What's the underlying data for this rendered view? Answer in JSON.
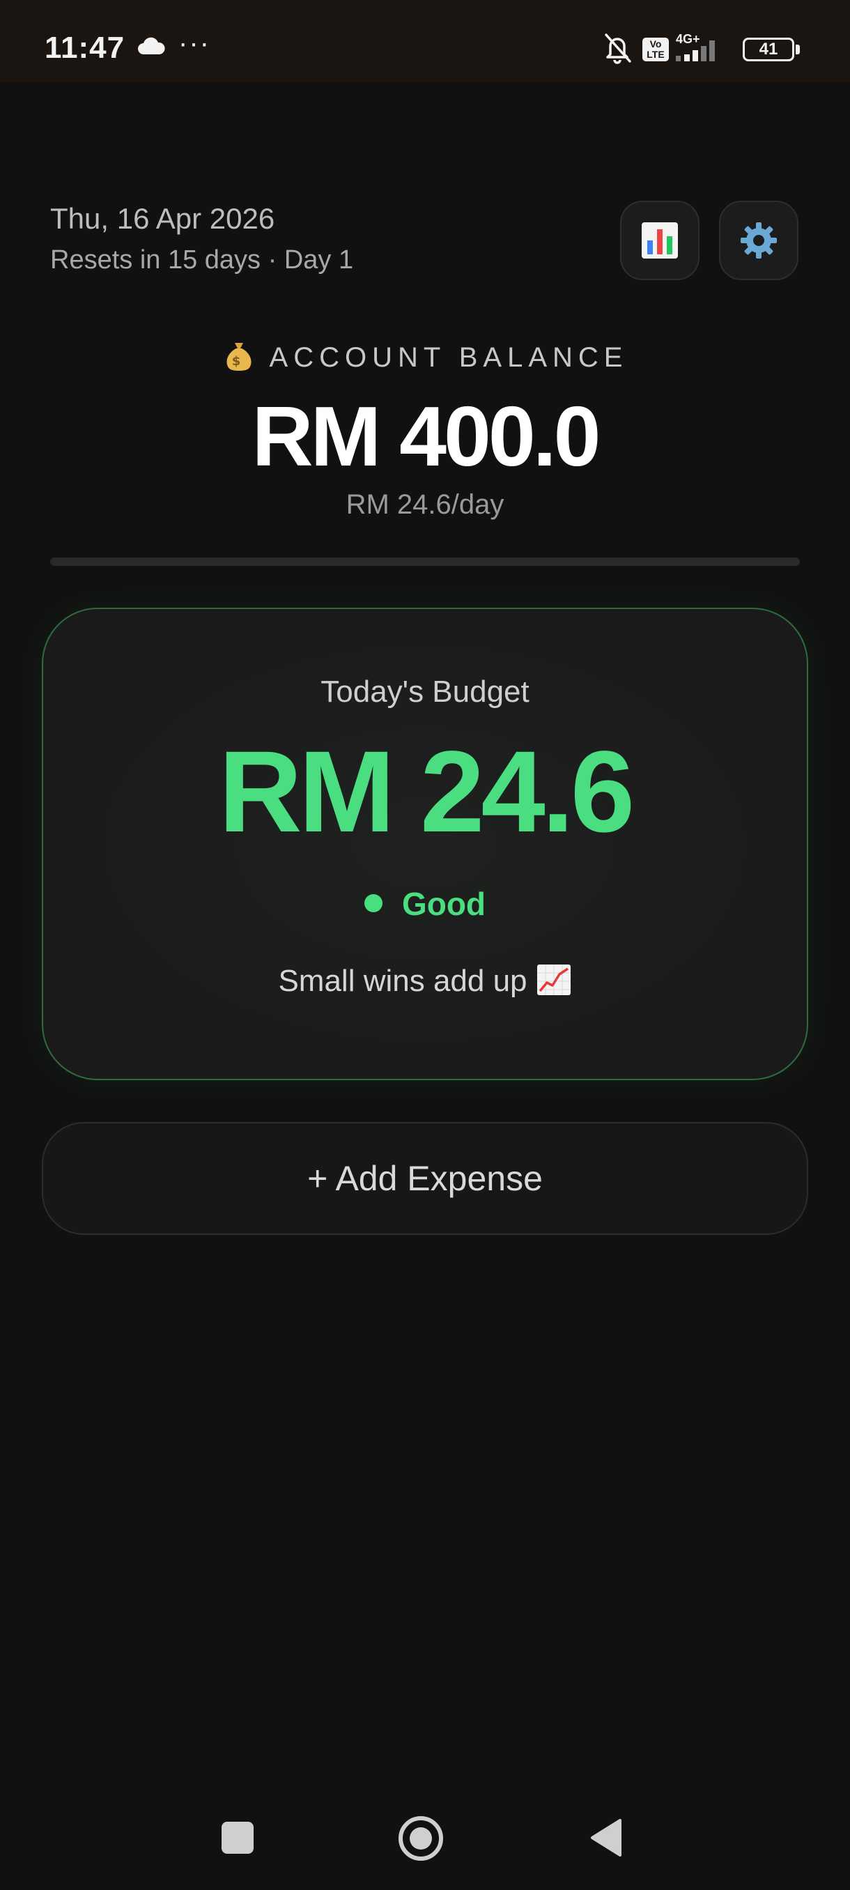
{
  "status_bar": {
    "time": "11:47",
    "more": "···",
    "volte": "Vo LTE",
    "network": "4G+",
    "battery": "41"
  },
  "header": {
    "date": "Thu, 16 Apr 2026",
    "reset_info": "Resets in 15 days · Day 1",
    "stats_button_icon": "bar-chart-icon",
    "settings_button_icon": "gear-icon"
  },
  "balance": {
    "icon": "money-bag-icon",
    "label": "ACCOUNT BALANCE",
    "value": "RM 400.0",
    "per_day": "RM 24.6/day",
    "progress_fraction": 0
  },
  "budget_card": {
    "title": "Today's Budget",
    "value": "RM 24.6",
    "status": "Good",
    "message": "Small wins add up",
    "message_icon": "chart-increasing-icon"
  },
  "actions": {
    "add_expense_label": "+ Add Expense"
  },
  "colors": {
    "background": "#111111",
    "accent_green": "#4ade80",
    "card_border": "#2f6b40"
  }
}
